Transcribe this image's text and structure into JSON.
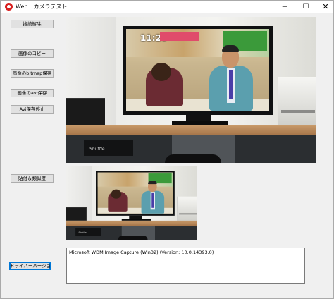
{
  "window": {
    "title": "Web　カメラテスト",
    "controls": {
      "minimize": "─",
      "maximize": "☐",
      "close": "✕"
    }
  },
  "buttons": {
    "connect": "接続解除",
    "copy_image": "画像のコピー",
    "save_bitmap": "画像のbitmap保存",
    "save_avi": "画像のavi保存",
    "stop_avi": "Avi保存停止",
    "paste_compare": "貼付＆類似度",
    "driver_version": "ドライバーバージョン"
  },
  "preview_large": {
    "overlay_text": "Shuttle",
    "screen_clock": "11:20"
  },
  "preview_small": {
    "overlay_text": "Shuttle"
  },
  "driver_info": {
    "text": "Microsoft WDM Image Capture (Win32) (Version:  10.0.14393.0)"
  },
  "colors": {
    "window_bg": "#f0f0f0",
    "button_bg": "#e1e1e1",
    "focus_border": "#0078d7",
    "app_icon": "#d81e1e"
  },
  "icons": {
    "app": "camera-app-icon"
  }
}
